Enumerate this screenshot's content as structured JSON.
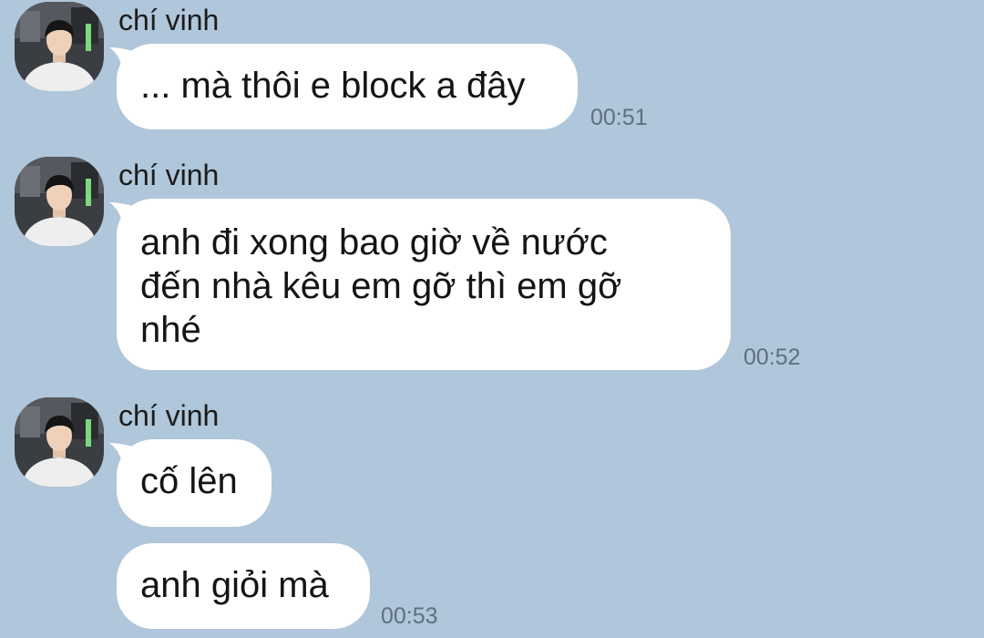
{
  "messages": [
    {
      "sender": "chí vinh",
      "avatar_icon": "user-photo",
      "bubbles": [
        {
          "lines": [
            "... mà thôi e block a đây"
          ]
        }
      ],
      "time": "00:51"
    },
    {
      "sender": "chí vinh",
      "avatar_icon": "user-photo",
      "bubbles": [
        {
          "lines": [
            "anh đi xong bao giờ về nước",
            "đến nhà kêu em gỡ thì em gỡ",
            "nhé"
          ]
        }
      ],
      "time": "00:52"
    },
    {
      "sender": "chí vinh",
      "avatar_icon": "user-photo",
      "bubbles": [
        {
          "lines": [
            "cố lên"
          ]
        },
        {
          "lines": [
            "anh giỏi mà"
          ]
        }
      ],
      "time": "00:53"
    }
  ],
  "colors": {
    "background": "#b0c6da",
    "bubble": "#ffffff",
    "timestamp": "#5f6f7e"
  }
}
